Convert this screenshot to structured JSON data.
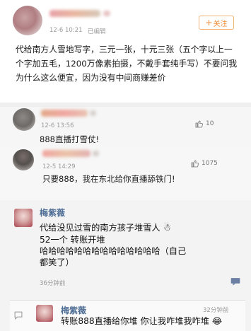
{
  "post": {
    "time": "12-6 10:21",
    "edited": "已编辑",
    "follow_label": "关注",
    "follow_plus": "+",
    "text": "代给南方人雪地写字，三元一张，十元三张（五个字以上一个字加五毛，1200万像素拍摄，不戴手套纯手写）不要问我为什么这么便宜，因为没有中间商赚差价"
  },
  "comments": [
    {
      "time": "12-6 13:56",
      "text": "888直播打雪仗!",
      "likes": "10"
    },
    {
      "time": "12-5 14:29",
      "text": "只要888，我在东北给你直播舔铁门!",
      "likes": "1075"
    }
  ],
  "reply1": {
    "name": "梅紫薇",
    "line1": "代给没见过雪的南方孩子堆雪人",
    "snowman": "☃",
    "line2": "52一个 转账开堆",
    "line3": "哈哈哈哈哈哈哈哈哈哈哈哈哈哈（自己",
    "line4": "都笑了）",
    "time": "36分钟前"
  },
  "reply2": {
    "name": "梅紫薇",
    "time": "32分钟前",
    "text": "转账888直播给你堆 你让我咋堆我咋堆",
    "emoji": "😂"
  },
  "colors": {
    "accent": "#ef8a30",
    "name_blue": "#4f6e95"
  }
}
